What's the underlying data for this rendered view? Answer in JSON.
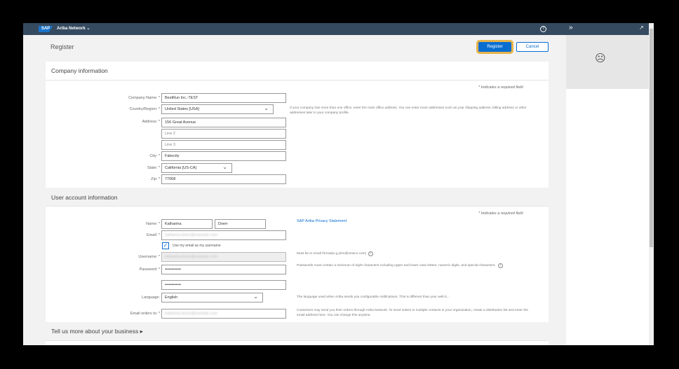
{
  "header": {
    "app_name": "Ariba Network ⌄",
    "logo": "SAP",
    "help_icon": "?"
  },
  "page": {
    "title": "Register",
    "register_label": "Register",
    "cancel_label": "Cancel"
  },
  "company": {
    "section_title": "Company information",
    "required_note": "Indicates a required field",
    "company_name_label": "Company Name: *",
    "company_name": "BestRun Inc.-TEST",
    "country_label": "Country/Region: *",
    "country": "United States  [USA]",
    "country_help": "If your company has more than one office, enter the main office address. You can enter more addresses such as your shipping address, billing address or other addresses later in your company profile.",
    "address_label": "Address: *",
    "address1": "156 Great Avenue",
    "address2_placeholder": "Line 2",
    "address3_placeholder": "Line 3",
    "city_label": "City: *",
    "city": "Fakecity",
    "state_label": "State: *",
    "state": "California  [US-CA]",
    "zip_label": "Zip: *",
    "zip": "77068"
  },
  "user": {
    "section_title": "User account information",
    "required_note": "Indicates a required field",
    "privacy_link": "SAP Ariba Privacy Statement",
    "name_label": "Name: *",
    "first_name": "Katharina",
    "last_name": "Doerr",
    "email_label": "Email: *",
    "email": "katharina.doerr@example.com",
    "use_email_label": "Use my email as my username",
    "use_email_checked": true,
    "username_label": "Username: *",
    "username": "katharina.doerr@example.com",
    "username_help": "Must be in email format(e.g john@newco.com)",
    "password_label": "Password: *",
    "password": "••••••••••••",
    "password_confirm": "••••••••••••",
    "password_help": "Passwords must contain a minimum of eight characters including upper and lower case letters, numeric digits, and special characters.",
    "language_label": "Language:",
    "language": "English",
    "language_help": "The language used when Ariba sends you configurable notifications. This is different than your web b...",
    "email_orders_label": "Email orders to: *",
    "email_orders": "katharina.doerr@example.com",
    "email_orders_help": "Customers may send you their orders through Ariba Network. To send orders to multiple contacts in your organization, create a distribution list and enter the email address here. You can change this anytime."
  },
  "more": {
    "label": "Tell us more about your business ▸"
  },
  "side_panel": {
    "expand_icon": "»",
    "popout_icon": "↗",
    "doc_icon": "☹"
  }
}
